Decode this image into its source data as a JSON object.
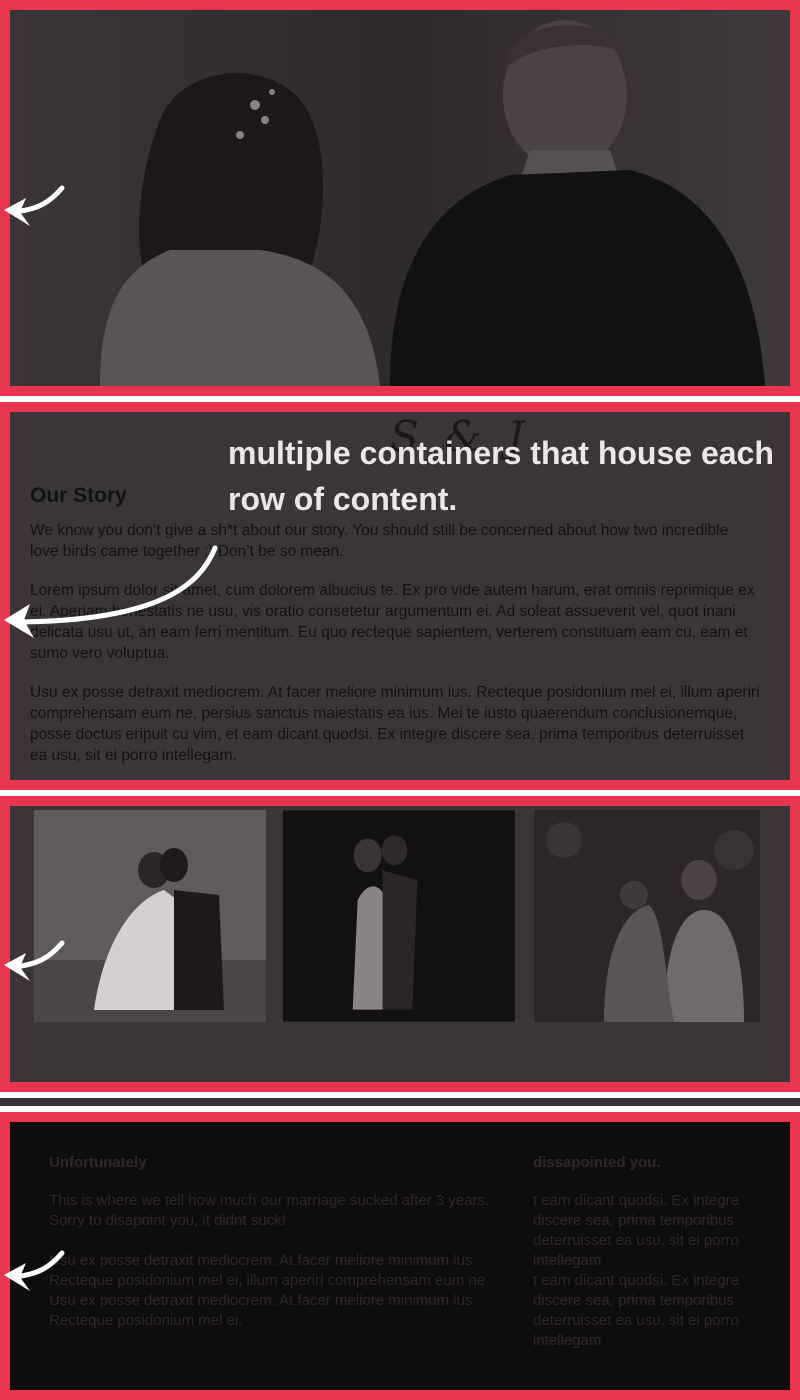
{
  "overlay": {
    "caption": "multiple containers that house each row of content."
  },
  "story": {
    "heading": "Our Story",
    "decor_script": "S & J",
    "paragraphs": [
      "We know you don’t give a sh*t about our story. You should still be concerned about how two incredible love birds came together :) Don’t be so mean.",
      "Lorem ipsum dolor sit amet, cum dolorem albucius te. Ex pro vide autem harum, erat omnis reprimique ex ei. Aperiam honestatis ne usu, vis oratio consetetur argumentum ei. Ad soleat assueverit vel, quot inani delicata usu ut, an eam ferri mentitum. Eu quo recteque sapientem, verterem constituam eam cu, eam et sumo vero voluptua.",
      "Usu ex posse detraxit mediocrem. At facer meliore minimum ius. Recteque posidonium mel ei, illum aperiri comprehensam eum ne, persius sanctus maiestatis ea ius. Mei te iusto quaerendum conclusionemque, posse doctus eripuit cu vim, et eam dicant quodsi. Ex integre discere sea, prima temporibus deterruisset ea usu, sit ei porro intellegam."
    ]
  },
  "footer": {
    "left": {
      "heading": "Unfortunately",
      "p1": "This is where we tell how much our marriage sucked after 3 years. Sorry to disapoint you, it didnt suck!",
      "p2": "Usu ex posse detraxit mediocrem. At facer meliore minimum ius. Recteque posidonium mel ei, illum aperiri comprehensam eum ne",
      "p3": "Usu ex posse detraxit mediocrem. At facer meliore minimum ius. Recteque posidonium mel ei."
    },
    "right": {
      "heading": "dissapointed you.",
      "p1": "t eam dicant quodsi. Ex integre discere sea, prima temporibus deterruisset ea usu, sit ei porro intellegam",
      "p2": "t eam dicant quodsi. Ex integre discere sea, prima temporibus deterruisset ea usu, sit ei porro intellegam"
    }
  },
  "colors": {
    "container_border": "#e8364e",
    "arrow": "#ffffff",
    "hero_bg": "#2f2b2d",
    "section_bg": "#3a3638",
    "footer_bg": "#0f0c0e"
  },
  "icons": [
    "curved-arrow-icon"
  ]
}
